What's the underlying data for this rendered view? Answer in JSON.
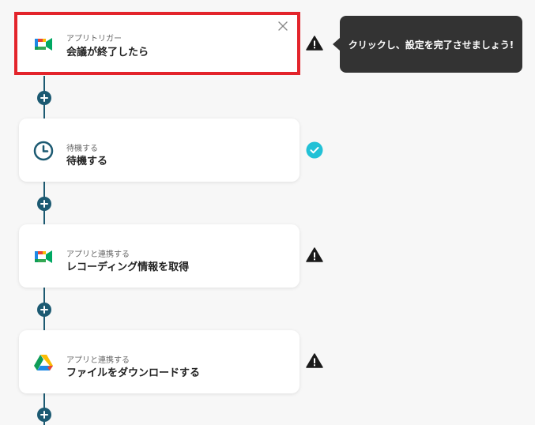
{
  "steps": [
    {
      "icon": "google-meet-icon",
      "subtitle": "アプリトリガー",
      "title": "会議が終了したら",
      "status": "warning",
      "active": true
    },
    {
      "icon": "clock-icon",
      "subtitle": "待機する",
      "title": "待機する",
      "status": "done"
    },
    {
      "icon": "google-meet-icon",
      "subtitle": "アプリと連携する",
      "title": "レコーディング情報を取得",
      "status": "warning"
    },
    {
      "icon": "google-drive-icon",
      "subtitle": "アプリと連携する",
      "title": "ファイルをダウンロードする",
      "status": "warning"
    }
  ],
  "tooltip": {
    "text": "クリックし、設定を完了させましょう!"
  },
  "colors": {
    "accent": "#1c5a72",
    "highlight_border": "#e3242b",
    "done": "#22c1d6",
    "tooltip_bg": "#333333"
  }
}
